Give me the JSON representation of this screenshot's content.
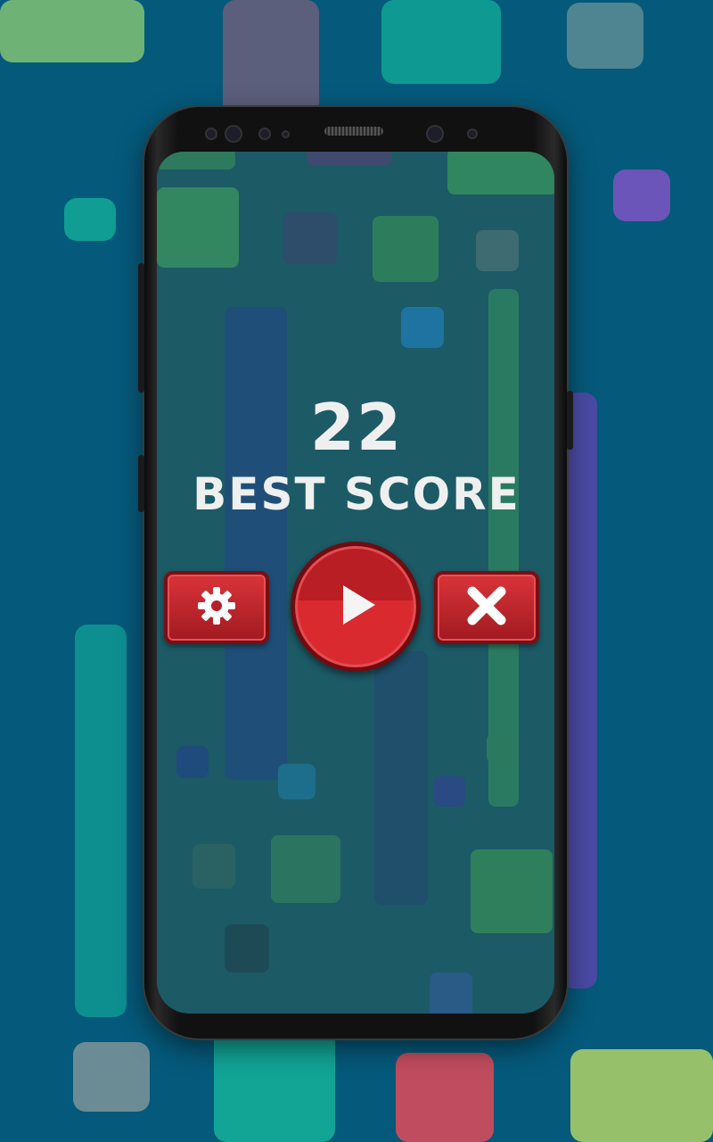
{
  "game": {
    "score": "22",
    "best_score_label": "BEST SCORE"
  },
  "buttons": {
    "settings_icon": "gear-icon",
    "play_icon": "play-icon",
    "close_icon": "close-icon"
  },
  "colors": {
    "background": "#05597a",
    "button_red": "#d9343a",
    "text": "#eef0ef"
  }
}
